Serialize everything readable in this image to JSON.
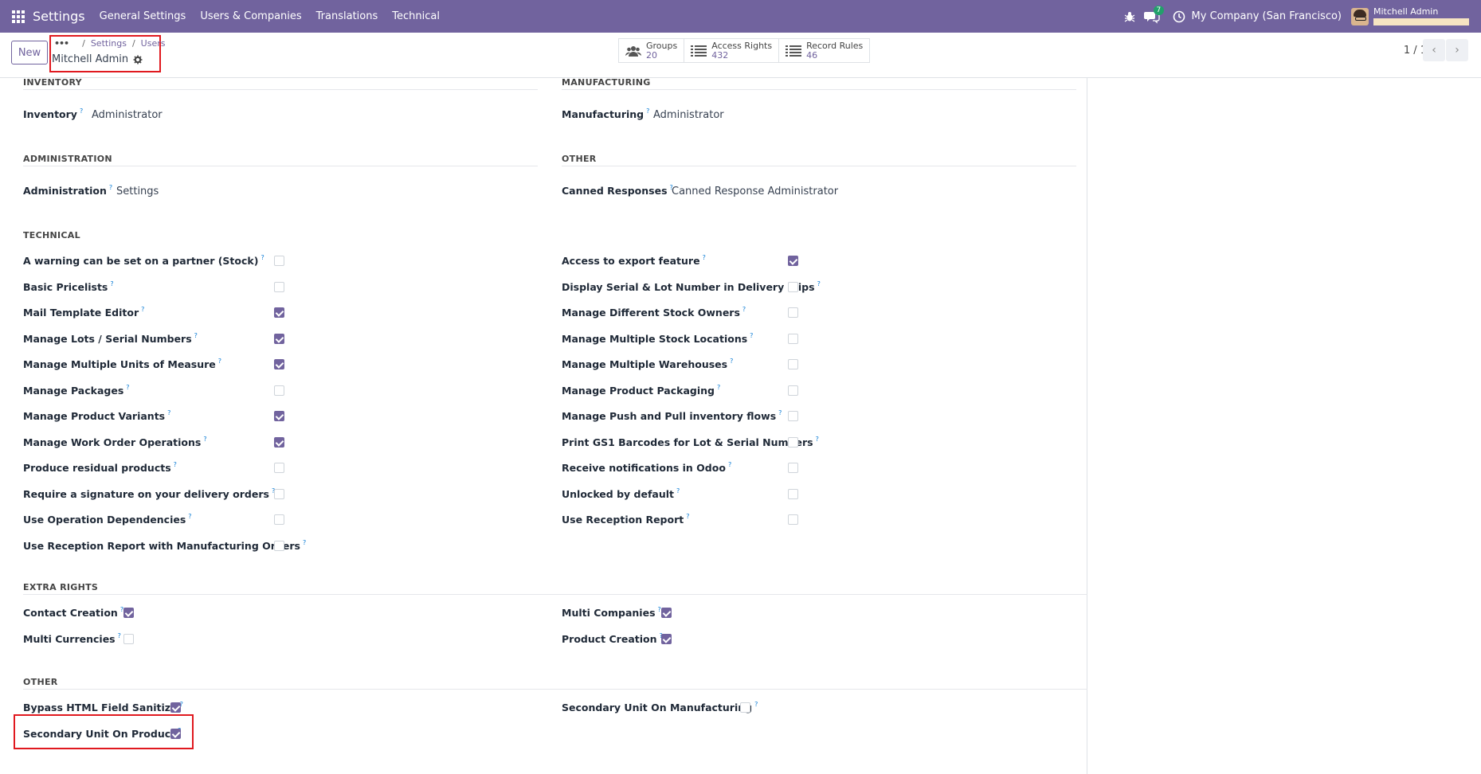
{
  "navbar": {
    "app_title": "Settings",
    "menus": [
      "General Settings",
      "Users & Companies",
      "Translations",
      "Technical"
    ],
    "chat_count": "7",
    "company": "My Company (San Francisco)",
    "user_name": "Mitchell Admin"
  },
  "control": {
    "new_label": "New",
    "breadcrumb": [
      "Settings",
      "Users"
    ],
    "record_name": "Mitchell Admin",
    "smart_buttons": [
      {
        "label": "Groups",
        "count": "20"
      },
      {
        "label": "Access Rights",
        "count": "432"
      },
      {
        "label": "Record Rules",
        "count": "46"
      }
    ],
    "pager": "1 / 1"
  },
  "sections": {
    "inventory": {
      "title": "INVENTORY",
      "label": "Inventory",
      "value": "Administrator"
    },
    "manufacturing": {
      "title": "MANUFACTURING",
      "label": "Manufacturing",
      "value": "Administrator"
    },
    "administration": {
      "title": "ADMINISTRATION",
      "label": "Administration",
      "value": "Settings"
    },
    "other_top": {
      "title": "OTHER",
      "label": "Canned Responses",
      "value": "Canned Response Administrator"
    },
    "technical": {
      "title": "TECHNICAL",
      "left": [
        {
          "label": "A warning can be set on a partner (Stock)",
          "checked": false
        },
        {
          "label": "Basic Pricelists",
          "checked": false
        },
        {
          "label": "Mail Template Editor",
          "checked": true
        },
        {
          "label": "Manage Lots / Serial Numbers",
          "checked": true
        },
        {
          "label": "Manage Multiple Units of Measure",
          "checked": true
        },
        {
          "label": "Manage Packages",
          "checked": false
        },
        {
          "label": "Manage Product Variants",
          "checked": true
        },
        {
          "label": "Manage Work Order Operations",
          "checked": true
        },
        {
          "label": "Produce residual products",
          "checked": false
        },
        {
          "label": "Require a signature on your delivery orders",
          "checked": false
        },
        {
          "label": "Use Operation Dependencies",
          "checked": false
        },
        {
          "label": "Use Reception Report with Manufacturing Orders",
          "checked": false
        }
      ],
      "right": [
        {
          "label": "Access to export feature",
          "checked": true
        },
        {
          "label": "Display Serial & Lot Number in Delivery Slips",
          "checked": false
        },
        {
          "label": "Manage Different Stock Owners",
          "checked": false
        },
        {
          "label": "Manage Multiple Stock Locations",
          "checked": false
        },
        {
          "label": "Manage Multiple Warehouses",
          "checked": false
        },
        {
          "label": "Manage Product Packaging",
          "checked": false
        },
        {
          "label": "Manage Push and Pull inventory flows",
          "checked": false
        },
        {
          "label": "Print GS1 Barcodes for Lot & Serial Numbers",
          "checked": false
        },
        {
          "label": "Receive notifications in Odoo",
          "checked": false
        },
        {
          "label": "Unlocked by default",
          "checked": false
        },
        {
          "label": "Use Reception Report",
          "checked": false
        }
      ]
    },
    "extra_rights": {
      "title": "EXTRA RIGHTS",
      "left": [
        {
          "label": "Contact Creation",
          "checked": true
        },
        {
          "label": "Multi Currencies",
          "checked": false
        }
      ],
      "right": [
        {
          "label": "Multi Companies",
          "checked": true
        },
        {
          "label": "Product Creation",
          "checked": true
        }
      ]
    },
    "other_bottom": {
      "title": "OTHER",
      "left": [
        {
          "label": "Bypass HTML Field Sanitize",
          "checked": true
        },
        {
          "label": "Secondary Unit On Product",
          "checked": true
        }
      ],
      "right": [
        {
          "label": "Secondary Unit On Manufacturing",
          "checked": false
        }
      ]
    }
  },
  "help_mark": "?"
}
